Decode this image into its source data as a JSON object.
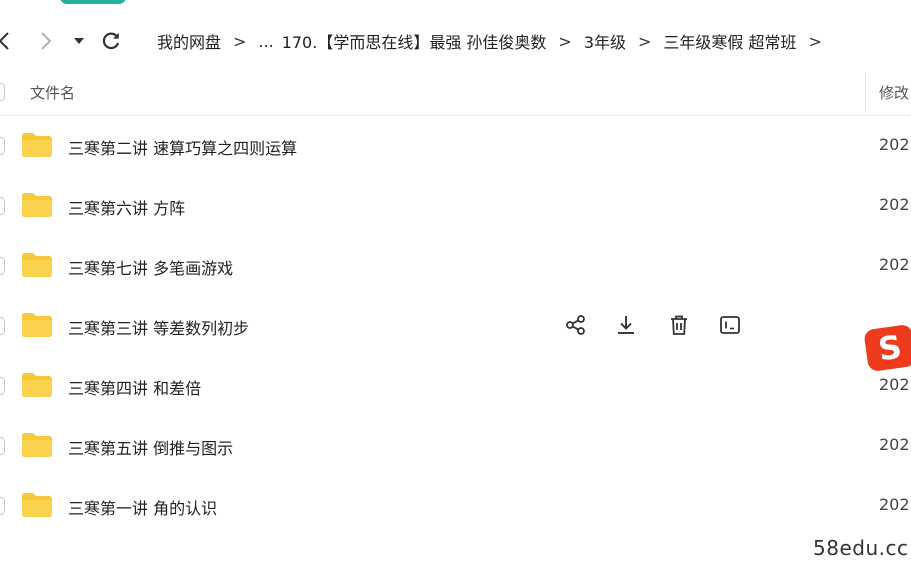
{
  "breadcrumb": {
    "items": [
      "我的网盘",
      "...",
      "170.【学而思在线】最强 孙佳俊奥数",
      "3年级",
      "三年级寒假 超常班"
    ],
    "separator": ">"
  },
  "header": {
    "name_label": "文件名",
    "modified_label": "修改"
  },
  "files": [
    {
      "name": "三寒第二讲 速算巧算之四则运算",
      "date": "202"
    },
    {
      "name": "三寒第六讲 方阵",
      "date": "202"
    },
    {
      "name": "三寒第七讲 多笔画游戏",
      "date": "202"
    },
    {
      "name": "三寒第三讲 等差数列初步",
      "date": ""
    },
    {
      "name": "三寒第四讲 和差倍",
      "date": "202"
    },
    {
      "name": "三寒第五讲 倒推与图示",
      "date": "202"
    },
    {
      "name": "三寒第一讲 角的认识",
      "date": "202"
    }
  ],
  "row_actions": [
    "share-icon",
    "download-icon",
    "delete-icon",
    "rename-icon"
  ],
  "sogou_badge": "S",
  "watermark": "58edu.cc",
  "colors": {
    "folder": "#f8c83a",
    "accent": "#1fb0a0",
    "sogou": "#ee3b1d"
  }
}
